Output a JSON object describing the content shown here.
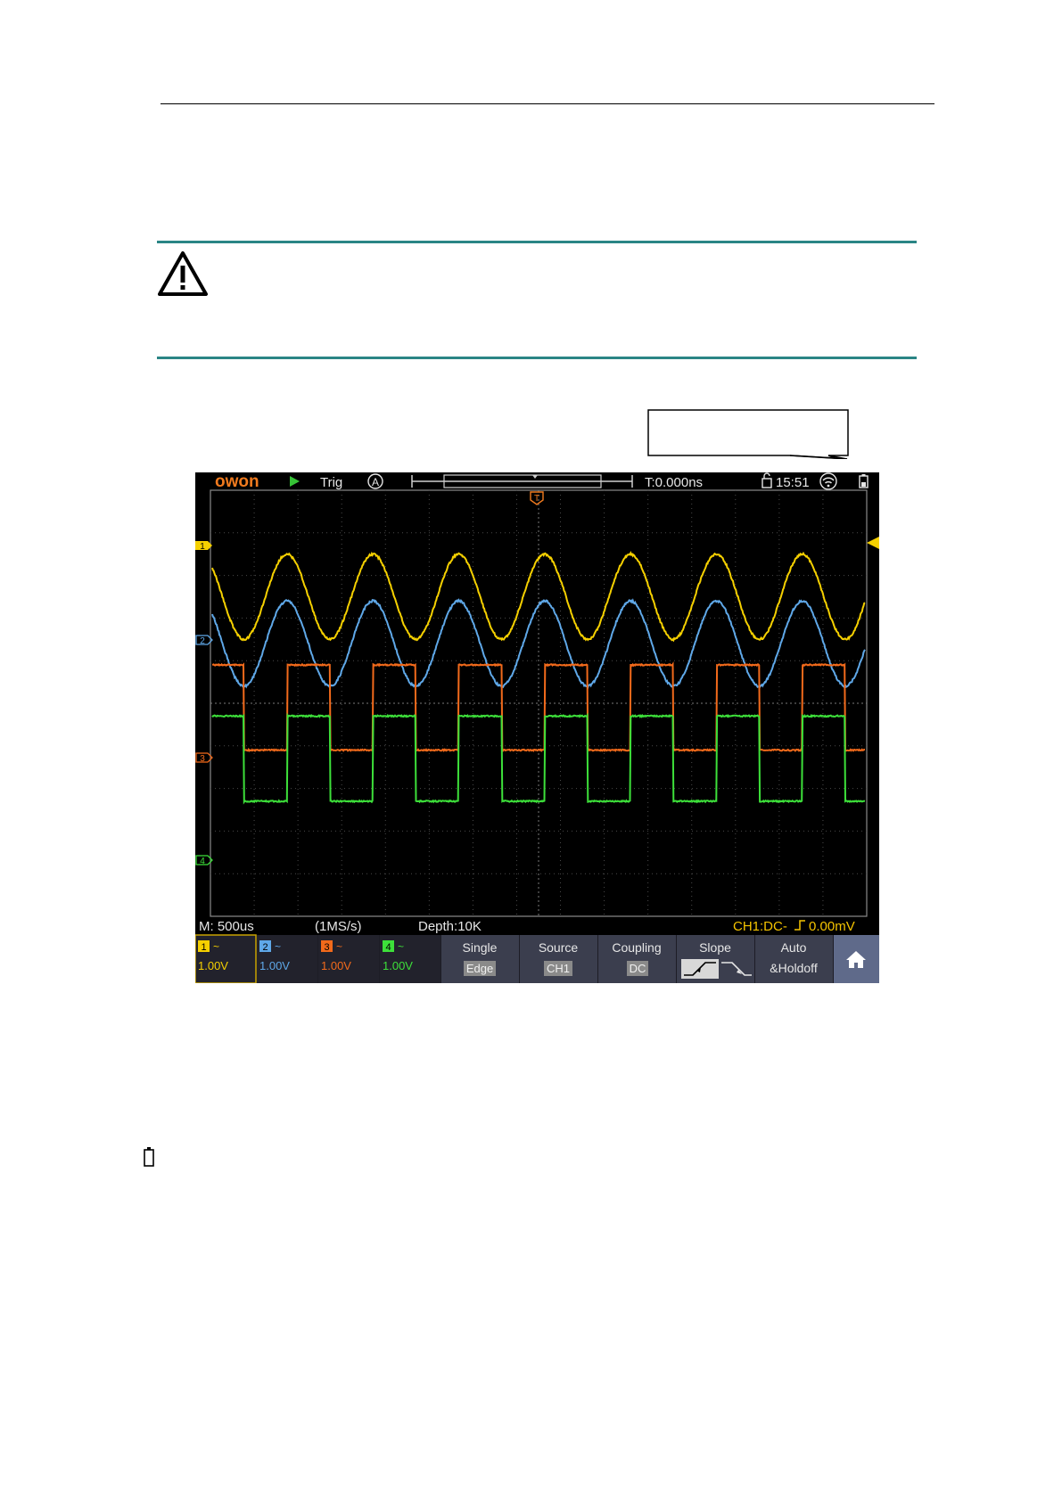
{
  "scope": {
    "logo": "owon",
    "run_state_icon": "play-icon",
    "trig_label": "Trig",
    "trig_mode": "A",
    "trigger_time": "T:0.000ns",
    "clock": "15:51",
    "status_icons": [
      "lock-icon",
      "wifi-icon",
      "battery-icon"
    ],
    "timebase": "M: 500us",
    "sample_rate": "(1MS/s)",
    "depth": "Depth:10K",
    "trigger_info": "CH1:DC-",
    "trigger_level": "0.00mV",
    "trigger_marker": "T",
    "channels": [
      {
        "num": "1",
        "coupling": "~",
        "scale": "1.00V",
        "color": "#f5d000"
      },
      {
        "num": "2",
        "coupling": "~",
        "scale": "1.00V",
        "color": "#5fa8e8"
      },
      {
        "num": "3",
        "coupling": "~",
        "scale": "1.00V",
        "color": "#f26a1b"
      },
      {
        "num": "4",
        "coupling": "~",
        "scale": "1.00V",
        "color": "#3de03a"
      }
    ],
    "menu": [
      {
        "top": "Single",
        "bottom": "Edge"
      },
      {
        "top": "Source",
        "bottom": "CH1"
      },
      {
        "top": "Coupling",
        "bottom": "DC"
      },
      {
        "top": "Slope",
        "bottom": ""
      },
      {
        "top": "Auto",
        "bottom": "&Holdoff"
      }
    ],
    "home_icon": "home-icon"
  },
  "chart_data": {
    "type": "line",
    "title": "",
    "xlabel": "",
    "ylabel": "",
    "series": [
      {
        "name": "",
        "shape": "sine",
        "cycles_on_screen": 7.6,
        "amplitude_div": 1.0,
        "center_div": 2.5,
        "color": "#f5d000"
      },
      {
        "name": "",
        "shape": "sine",
        "cycles_on_screen": 7.6,
        "amplitude_div": 1.0,
        "center_div": 1.4,
        "color": "#5fa8e8"
      },
      {
        "name": "",
        "shape": "square",
        "cycles_on_screen": 7.6,
        "amplitude_div": 1.0,
        "center_div": -0.1,
        "color": "#f26a1b"
      },
      {
        "name": "",
        "shape": "square",
        "cycles_on_screen": 7.6,
        "amplitude_div": 1.0,
        "center_div": -1.3,
        "color": "#3de03a"
      }
    ],
    "grid": true,
    "x_divisions": 15,
    "y_divisions": 10
  }
}
